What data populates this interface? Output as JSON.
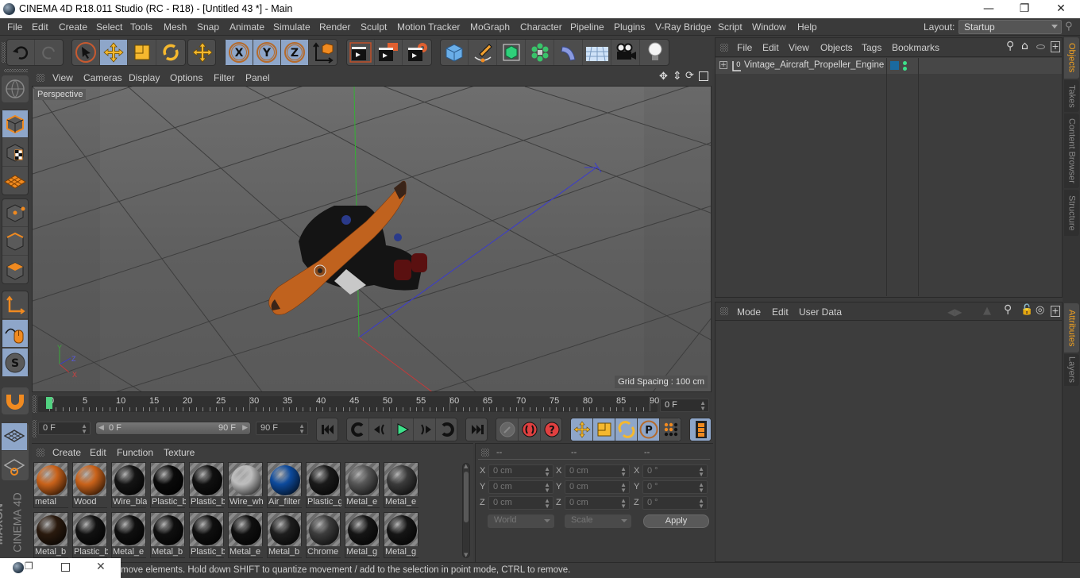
{
  "window": {
    "title": "CINEMA 4D R18.011 Studio (RC - R18) - [Untitled 43 *] - Main",
    "minimize_icon": "minimize-icon",
    "maximize_icon": "restore-icon",
    "close_icon": "close-icon"
  },
  "menubar": {
    "items": [
      "File",
      "Edit",
      "Create",
      "Select",
      "Tools",
      "Mesh",
      "Snap",
      "Animate",
      "Simulate",
      "Render",
      "Sculpt",
      "Motion Tracker",
      "MoGraph",
      "Character",
      "Pipeline",
      "Plugins",
      "V-Ray Bridge",
      "Script",
      "Window",
      "Help"
    ],
    "layout_label": "Layout:",
    "layout_value": "Startup"
  },
  "toolbar": {
    "icons": [
      "undo-icon",
      "redo-icon",
      "live-selection-icon",
      "move-icon",
      "scale-icon",
      "rotate-icon",
      "recent-tool-icon",
      "x-axis-lock-icon",
      "y-axis-lock-icon",
      "z-axis-lock-icon",
      "coordinate-system-icon",
      "render-view-icon",
      "render-picture-viewer-icon",
      "render-settings-icon",
      "cube-icon",
      "pen-spline-icon",
      "subdivision-icon",
      "cloner-icon",
      "deformer-icon",
      "floor-icon",
      "camera-icon",
      "light-icon"
    ]
  },
  "left_tools": {
    "icons": [
      "make-editable-icon",
      "model-mode-icon",
      "texture-mode-icon",
      "workplane-icon",
      "points-mode-icon",
      "edges-mode-icon",
      "polygons-mode-icon",
      "axis-mode-icon",
      "tweak-mode-icon",
      "solo-mode-icon",
      "snap-magnet-icon"
    ]
  },
  "viewport": {
    "menu": [
      "View",
      "Cameras",
      "Display",
      "Options",
      "Filter",
      "Panel"
    ],
    "camera_label": "Perspective",
    "grid_spacing": "Grid Spacing : 100 cm",
    "axis_labels": {
      "x": "X",
      "y": "Y",
      "z": "Z"
    },
    "nav_icons": [
      "pan-icon",
      "zoom-icon",
      "orbit-icon",
      "maximize-view-icon"
    ]
  },
  "timeline": {
    "ticks": [
      "0",
      "5",
      "10",
      "15",
      "20",
      "25",
      "30",
      "35",
      "40",
      "45",
      "50",
      "55",
      "60",
      "65",
      "70",
      "75",
      "80",
      "85",
      "90"
    ],
    "current_frame_display": "0 F",
    "start_frame": "0 F",
    "range_start": "0 F",
    "range_end": "90 F",
    "end_frame": "90 F",
    "playhead_frame": 0,
    "max_frame": 90
  },
  "transport": {
    "buttons": [
      "go-to-start-icon",
      "previous-key-icon",
      "previous-frame-icon",
      "play-icon",
      "next-frame-icon",
      "next-key-icon",
      "go-to-end-icon",
      "record-keys-icon",
      "autokey-icon",
      "keyframe-selection-icon",
      "key-position-icon",
      "key-scale-icon",
      "key-rotation-icon",
      "key-parameter-icon",
      "key-pla-icon",
      "timeline-icon"
    ]
  },
  "materials": {
    "menu": [
      "Create",
      "Edit",
      "Function",
      "Texture"
    ],
    "items": [
      {
        "name": "metal",
        "color": "#c9621a"
      },
      {
        "name": "Wood",
        "color": "#c9621a"
      },
      {
        "name": "Wire_bla",
        "color": "#141414"
      },
      {
        "name": "Plastic_b",
        "color": "#0a0a0a"
      },
      {
        "name": "Plastic_b",
        "color": "#101010"
      },
      {
        "name": "Wire_wh",
        "color": "#bdbdbd"
      },
      {
        "name": "Air_filter",
        "color": "#0d4a9c"
      },
      {
        "name": "Plastic_g",
        "color": "#1a1a1a"
      },
      {
        "name": "Metal_e",
        "color": "#555555"
      },
      {
        "name": "Metal_e",
        "color": "#3a3a3a"
      },
      {
        "name": "Metal_b",
        "color": "#2a1a0e"
      },
      {
        "name": "Plastic_b",
        "color": "#111111"
      },
      {
        "name": "Metal_e",
        "color": "#0f0f0f"
      },
      {
        "name": "Metal_b",
        "color": "#0f0f0f"
      },
      {
        "name": "Plastic_b",
        "color": "#0f0f0f"
      },
      {
        "name": "Metal_e",
        "color": "#0f0f0f"
      },
      {
        "name": "Metal_b",
        "color": "#1e1e1e"
      },
      {
        "name": "Chrome",
        "color": "#3c3c3c"
      },
      {
        "name": "Metal_g",
        "color": "#151515"
      },
      {
        "name": "Metal_g",
        "color": "#151515"
      }
    ]
  },
  "coordinates": {
    "headers": [
      "--",
      "--",
      "--"
    ],
    "rows": [
      {
        "axis": "X",
        "pos": "0 cm",
        "size": "0 cm",
        "rot": "0 °"
      },
      {
        "axis": "Y",
        "pos": "0 cm",
        "size": "0 cm",
        "rot": "0 °"
      },
      {
        "axis": "Z",
        "pos": "0 cm",
        "size": "0 cm",
        "rot": "0 °"
      }
    ],
    "space_select": "World",
    "mode_select": "Scale",
    "apply_label": "Apply"
  },
  "objects": {
    "menu": [
      "File",
      "Edit",
      "View",
      "Objects",
      "Tags",
      "Bookmarks"
    ],
    "items": [
      {
        "name": "Vintage_Aircraft_Propeller_Engine",
        "layer_color": "#1a6aa0",
        "dot_color": "#3de08a"
      }
    ]
  },
  "attributes": {
    "menu": [
      "Mode",
      "Edit",
      "User Data"
    ]
  },
  "right_tabs": {
    "top": [
      {
        "label": "Objects",
        "active": true
      },
      {
        "label": "Takes",
        "active": false
      },
      {
        "label": "Content Browser",
        "active": false
      },
      {
        "label": "Structure",
        "active": false
      }
    ],
    "bottom": [
      {
        "label": "Attributes",
        "active": true
      },
      {
        "label": "Layers",
        "active": false
      }
    ]
  },
  "brand": {
    "text1": "MAXON",
    "text2": "CINEMA 4D"
  },
  "status": {
    "message": "move elements. Hold down SHIFT to quantize movement / add to the selection in point mode, CTRL to remove."
  },
  "colors": {
    "accent_orange": "#f0a020",
    "selected_blue": "#8ea6c9",
    "playhead_green": "#52d281",
    "axis_x": "#c23a3a",
    "axis_y": "#3aa83a",
    "axis_z": "#3a3ad0"
  }
}
